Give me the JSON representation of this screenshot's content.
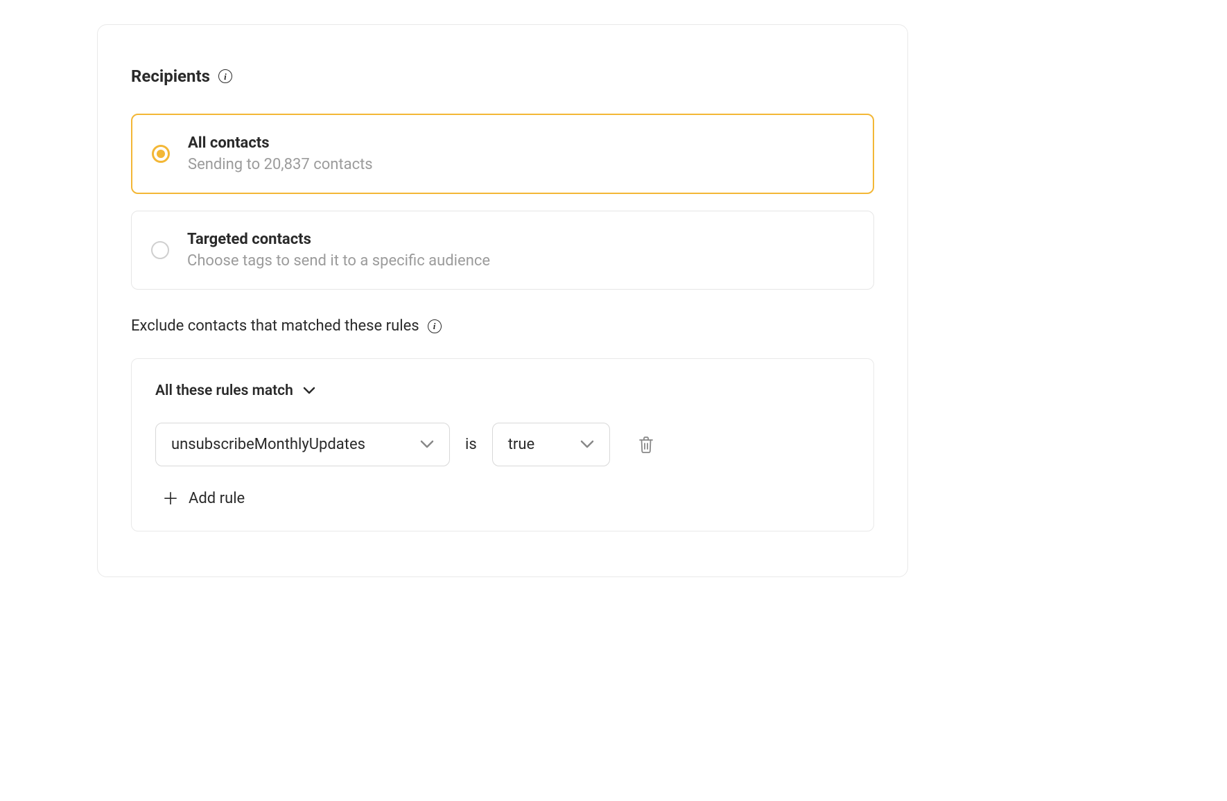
{
  "header": {
    "title": "Recipients"
  },
  "recipients": {
    "options": [
      {
        "title": "All contacts",
        "desc": "Sending to 20,837 contacts",
        "selected": true
      },
      {
        "title": "Targeted contacts",
        "desc": "Choose tags to send it to a specific audience",
        "selected": false
      }
    ]
  },
  "exclude": {
    "title": "Exclude contacts that matched these rules",
    "match_label": "All these rules match",
    "rules": [
      {
        "field": "unsubscribeMonthlyUpdates",
        "operator": "is",
        "value": "true"
      }
    ],
    "add_rule_label": "Add rule"
  }
}
